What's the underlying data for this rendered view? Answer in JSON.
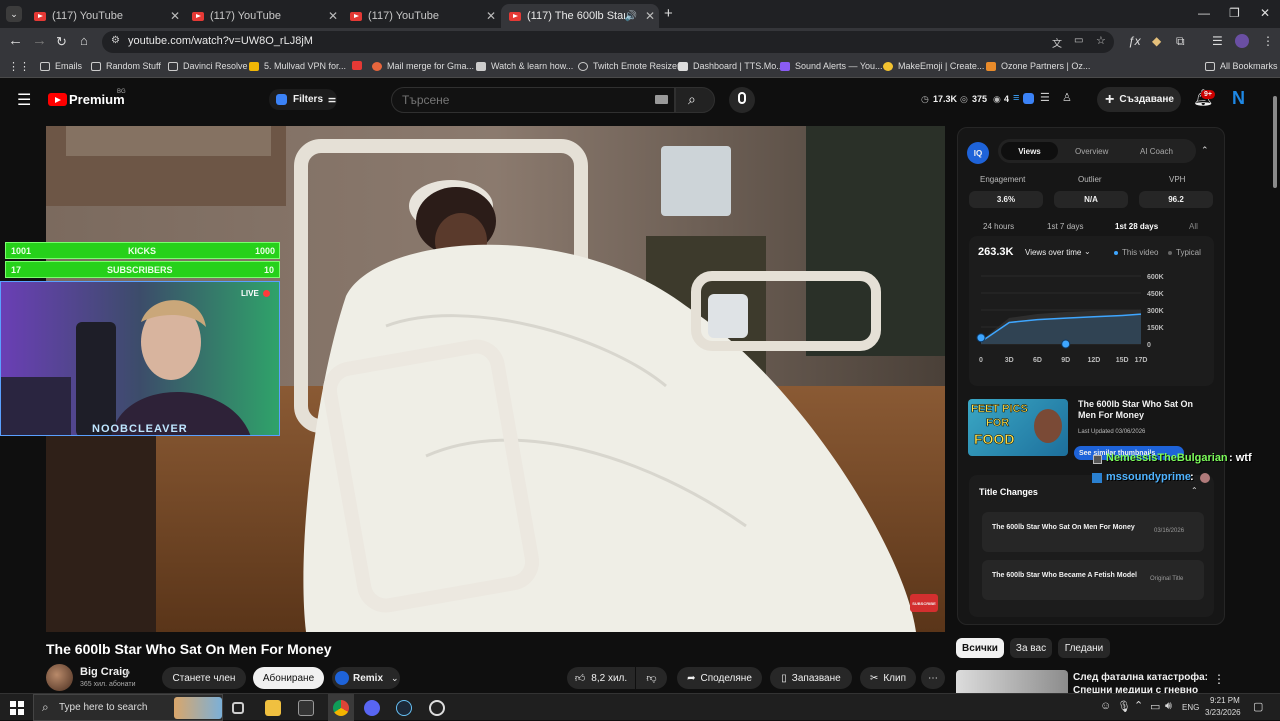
{
  "browser": {
    "tabs": [
      {
        "title": "(117) YouTube",
        "active": false
      },
      {
        "title": "(117) YouTube",
        "active": false
      },
      {
        "title": "(117) YouTube",
        "active": false
      },
      {
        "title": "(117) The 600lb Star Who S",
        "active": true
      }
    ],
    "url": "youtube.com/watch?v=UW8O_rLJ8jM",
    "bookmarks": [
      "Emails",
      "Random Stuff",
      "Davinci Resolve",
      "5. Mullvad VPN for...",
      "Mail merge for Gma...",
      "Watch & learn how...",
      "Twitch Emote Resizer",
      "Dashboard | TTS.Mo...",
      "Sound Alerts — You...",
      "MakeEmoji | Create...",
      "Ozone Partners | Oz..."
    ],
    "all_bookmarks": "All Bookmarks"
  },
  "youtube": {
    "premium_label": "Premium",
    "region": "BG",
    "filters_label": "Filters",
    "search_placeholder": "Търсене",
    "stats": {
      "views": "17.3K",
      "likes": "375",
      "count": "4"
    },
    "create_label": "Създаване",
    "notif_badge": "9+",
    "avatar_letter": "N"
  },
  "overlay": {
    "kicks": {
      "left": "1001",
      "label": "KICKS",
      "right": "1000"
    },
    "subs": {
      "left": "17",
      "label": "SUBSCRIBERS",
      "right": "10"
    },
    "live": "LIVE",
    "streamer": "NOOBCLEAVER",
    "subscribe_badge": "SUBSCRIBE"
  },
  "panel": {
    "iq": "IQ",
    "tabs": [
      "Views",
      "Overview",
      "AI Coach"
    ],
    "metrics": [
      {
        "label": "Engagement",
        "value": "3.6%"
      },
      {
        "label": "Outlier",
        "value": "N/A"
      },
      {
        "label": "VPH",
        "value": "96.2"
      }
    ],
    "ranges": [
      "24 hours",
      "1st 7 days",
      "1st 28 days",
      "All"
    ],
    "total_views": "263.3K",
    "dropdown": "Views over time",
    "legend": [
      "This video",
      "Typical"
    ],
    "similar_title": "The 600lb Star Who Sat On Men For Money",
    "last_updated": "Last Updated 03/06/2026",
    "thumb_text": [
      "FEET PICS",
      "FOR",
      "FOOD"
    ],
    "see_similar": "See similar thumbnails",
    "title_changes_label": "Title Changes",
    "title_changes": [
      {
        "title": "The 600lb Star Who Sat On Men For Money",
        "tag": "03/16/2026"
      },
      {
        "title": "The 600lb Star Who Became A Fetish Model",
        "tag": "Original Title"
      }
    ]
  },
  "chart_data": {
    "type": "line",
    "x": [
      0,
      3,
      6,
      9,
      12,
      15,
      17
    ],
    "xlabels": [
      "0",
      "3D",
      "6D",
      "9D",
      "12D",
      "15D",
      "17D"
    ],
    "yticks": [
      "600K",
      "450K",
      "300K",
      "150K",
      "0"
    ],
    "ylim": [
      0,
      600000
    ],
    "series": [
      {
        "name": "This video",
        "values": [
          20000,
          190000,
          215000,
          228000,
          240000,
          252000,
          263300
        ],
        "color": "#3ea6ff"
      },
      {
        "name": "Typical",
        "values": [
          30000,
          230000,
          265000,
          282000,
          292000,
          298000,
          302000
        ],
        "color": "#3a3a3a"
      }
    ]
  },
  "chat": [
    {
      "user": "NemessisTheBulgarian",
      "message": "wtf",
      "color": "#7cfc5a"
    },
    {
      "user": "mssoundyprime",
      "message": "",
      "color": "#4fb3ff"
    }
  ],
  "video": {
    "title": "The 600lb Star Who Sat On Men For Money",
    "channel": "Big Craig",
    "subscribers": "365 хил. абонати",
    "join": "Станете член",
    "subscribe": "Абониране",
    "remix": "Remix",
    "likes": "8,2 хил.",
    "share": "Споделяне",
    "save": "Запазване",
    "clip": "Клип"
  },
  "chips": [
    "Всички",
    "За вас",
    "Гледани"
  ],
  "recommended": {
    "title_line1": "След фатална катастрофа:",
    "title_line2": "Спешни медици с гневно"
  },
  "taskbar": {
    "search_placeholder": "Type here to search",
    "lang": "ENG",
    "time": "9:21 PM",
    "date": "3/23/2026"
  }
}
